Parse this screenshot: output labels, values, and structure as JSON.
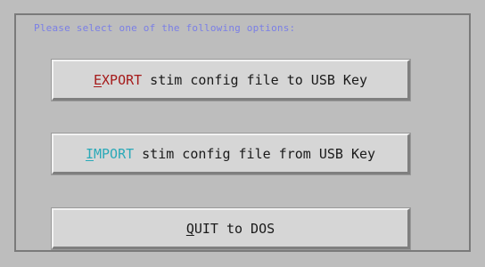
{
  "prompt": "Please select one of the following options:",
  "options": [
    {
      "hotkey": "E",
      "keyword_rest": "XPORT",
      "rest": "stim config file to USB Key",
      "keyword_color": "#a51a1a"
    },
    {
      "hotkey": "I",
      "keyword_rest": "MPORT",
      "rest": "stim config file from USB Key",
      "keyword_color": "#2aa9b8"
    },
    {
      "hotkey": "Q",
      "keyword_rest": "UIT",
      "rest": "to DOS",
      "keyword_color": "#1a1a1a"
    }
  ],
  "colors": {
    "background": "#bdbdbd",
    "prompt_text": "#7a7fe6",
    "button_face": "#d6d6d6"
  }
}
